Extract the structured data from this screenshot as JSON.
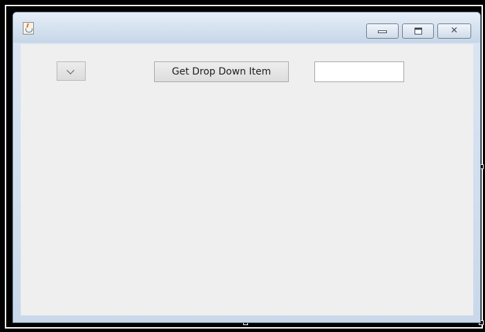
{
  "window": {
    "icon": "java-cup-icon",
    "title": "",
    "controls": {
      "minimize_icon": "minimize-icon",
      "maximize_icon": "maximize-icon",
      "close_icon": "close-icon",
      "close_glyph": "✕"
    }
  },
  "form": {
    "dropdown": {
      "selected": "",
      "icon": "chevron-down-icon"
    },
    "get_button_label": "Get Drop Down Item",
    "text_field": {
      "value": ""
    }
  },
  "colors": {
    "titlebar": "#d3e0ee",
    "content_background": "#efefef",
    "canvas_background": "#000000"
  }
}
